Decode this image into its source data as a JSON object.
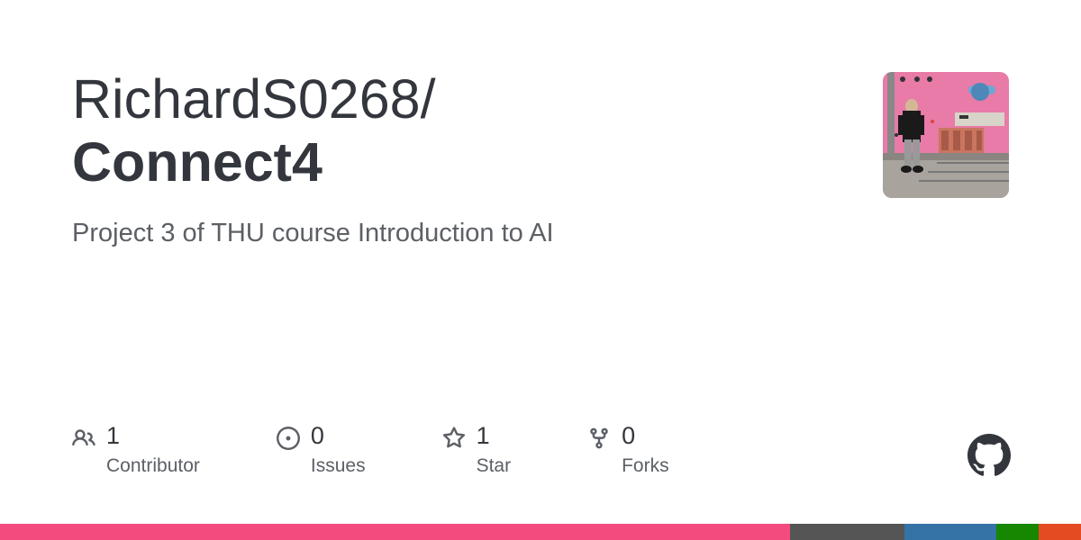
{
  "repo": {
    "owner": "RichardS0268",
    "separator": "/",
    "name": "Connect4",
    "description": "Project 3 of THU course Introduction to AI"
  },
  "stats": {
    "contributors": {
      "value": "1",
      "label": "Contributor"
    },
    "issues": {
      "value": "0",
      "label": "Issues"
    },
    "stars": {
      "value": "1",
      "label": "Star"
    },
    "forks": {
      "value": "0",
      "label": "Forks"
    }
  }
}
